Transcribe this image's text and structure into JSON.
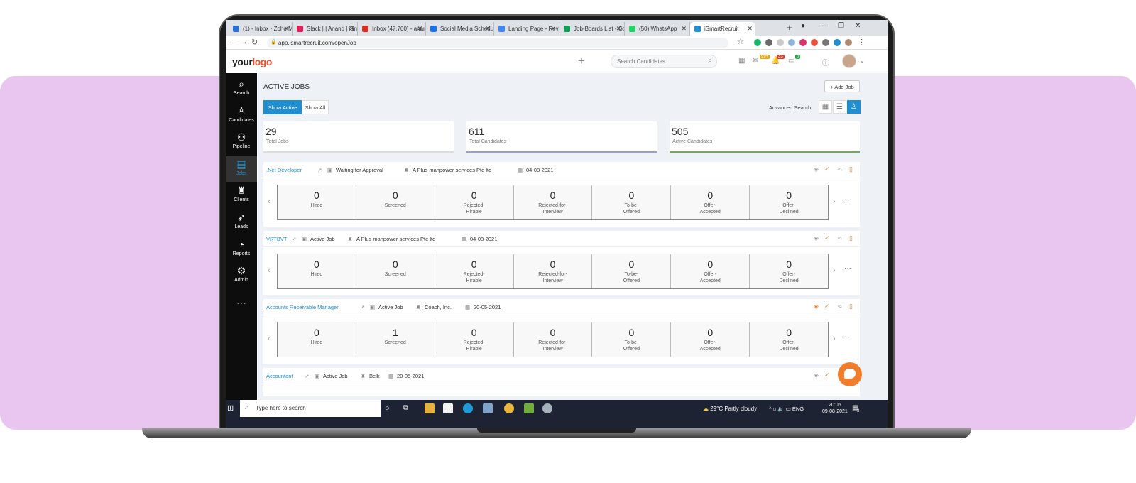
{
  "browser": {
    "tabs": [
      {
        "title": "(1) - Inbox - Zoho M",
        "icon_color": "#2a6fd6"
      },
      {
        "title": "Slack | | Anand | iSm",
        "icon_color": "#e01e5a"
      },
      {
        "title": "Inbox (47,700) - anan",
        "icon_color": "#d93025"
      },
      {
        "title": "Social Media Schedu",
        "icon_color": "#1a73e8"
      },
      {
        "title": "Landing Page - Rev",
        "icon_color": "#4285f4"
      },
      {
        "title": "Job-Boards List - Go",
        "icon_color": "#0f9d58"
      },
      {
        "title": "(50) WhatsApp",
        "icon_color": "#25d366"
      },
      {
        "title": "iSmartRecruit",
        "icon_color": "#1f8fd1"
      }
    ],
    "url": "app.ismartrecruit.com/openJob"
  },
  "app": {
    "logo_prefix": "your",
    "logo_suffix": "logo",
    "search_placeholder": "Search Candidates",
    "badges": {
      "mail": "99+",
      "bell": "33",
      "chat": "0"
    }
  },
  "sidebar": [
    {
      "label": "Search",
      "icon": "⌕"
    },
    {
      "label": "Candidates",
      "icon": "♙"
    },
    {
      "label": "Pipeline",
      "icon": "⚇"
    },
    {
      "label": "Jobs",
      "icon": "▤"
    },
    {
      "label": "Clients",
      "icon": "♜"
    },
    {
      "label": "Leads",
      "icon": "➶"
    },
    {
      "label": "Reports",
      "icon": "◔"
    },
    {
      "label": "Admin",
      "icon": "⚙"
    }
  ],
  "page": {
    "title": "ACTIVE JOBS",
    "add_job": "+ Add Job",
    "show_active": "Show Active",
    "show_all": "Show All",
    "advanced_search": "Advanced Search"
  },
  "stats": [
    {
      "value": "29",
      "label": "Total Jobs",
      "color": "#dddddd"
    },
    {
      "value": "611",
      "label": "Total Candidates",
      "color": "#9b9bd8"
    },
    {
      "value": "505",
      "label": "Active Candidates",
      "color": "#6ab04c"
    }
  ],
  "jobs": [
    {
      "title": ".Net Developer",
      "status": "Waiting for Approval",
      "client": "A Plus manpower services Pte ltd",
      "date": "04-08-2021",
      "stages": [
        {
          "count": "0",
          "label": "Hired"
        },
        {
          "count": "0",
          "label": "Screened"
        },
        {
          "count": "0",
          "label": "Rejected-\nHirable"
        },
        {
          "count": "0",
          "label": "Rejected-for-\nInterview"
        },
        {
          "count": "0",
          "label": "To-be-\nOffered"
        },
        {
          "count": "0",
          "label": "Offer-\nAccepted"
        },
        {
          "count": "0",
          "label": "Offer-\nDeclined"
        }
      ]
    },
    {
      "title": "VRTBVT",
      "status": "Active Job",
      "client": "A Plus manpower services Pte ltd",
      "date": "04-08-2021",
      "stages": [
        {
          "count": "0",
          "label": "Hired"
        },
        {
          "count": "0",
          "label": "Screened"
        },
        {
          "count": "0",
          "label": "Rejected-\nHirable"
        },
        {
          "count": "0",
          "label": "Rejected-for-\nInterview"
        },
        {
          "count": "0",
          "label": "To-be-\nOffered"
        },
        {
          "count": "0",
          "label": "Offer-\nAccepted"
        },
        {
          "count": "0",
          "label": "Offer-\nDeclined"
        }
      ]
    },
    {
      "title": "Accounts Receivable Manager",
      "status": "Active Job",
      "client": "Coach, Inc.",
      "date": "20-05-2021",
      "stages": [
        {
          "count": "0",
          "label": "Hired"
        },
        {
          "count": "1",
          "label": "Screened"
        },
        {
          "count": "0",
          "label": "Rejected-\nHirable"
        },
        {
          "count": "0",
          "label": "Rejected-for-\nInterview"
        },
        {
          "count": "0",
          "label": "To-be-\nOffered"
        },
        {
          "count": "0",
          "label": "Offer-\nAccepted"
        },
        {
          "count": "0",
          "label": "Offer-\nDeclined"
        }
      ]
    },
    {
      "title": "Accountant",
      "status": "Active Job",
      "client": "Belk",
      "date": "20-05-2021",
      "stages": []
    }
  ],
  "taskbar": {
    "search_placeholder": "Type here to search",
    "weather": "29°C  Partly cloudy",
    "lang": "ENG",
    "time": "20:06",
    "date": "09-08-2021",
    "notifications": "3"
  }
}
